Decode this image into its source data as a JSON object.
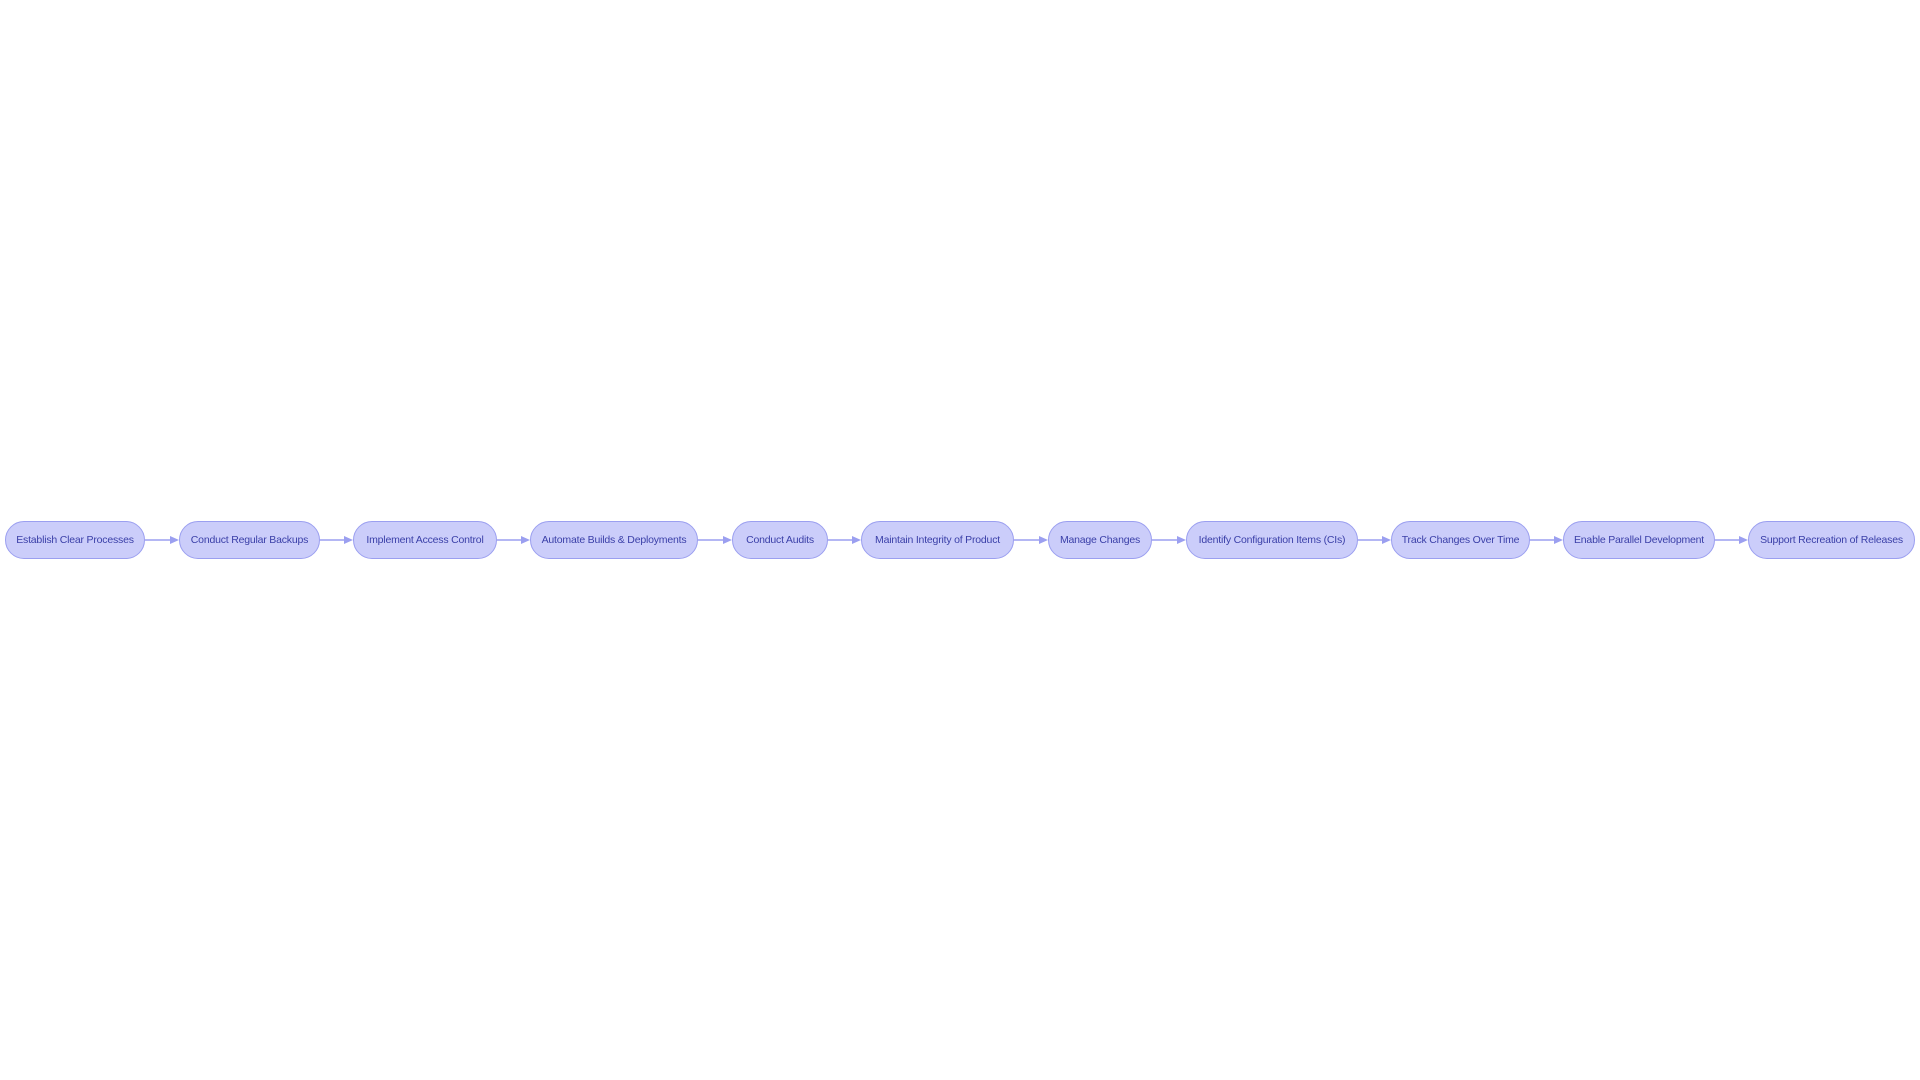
{
  "diagram": {
    "type": "flowchart",
    "direction": "left-to-right",
    "colors": {
      "node_fill": "#cbcdfa",
      "node_border": "#9b9ff0",
      "node_text": "#3a3fa8",
      "edge": "#9b9ff0",
      "background": "#ffffff"
    },
    "nodes": [
      {
        "id": "n1",
        "label": "Establish Clear Processes"
      },
      {
        "id": "n2",
        "label": "Conduct Regular Backups"
      },
      {
        "id": "n3",
        "label": "Implement Access Control"
      },
      {
        "id": "n4",
        "label": "Automate Builds & Deployments"
      },
      {
        "id": "n5",
        "label": "Conduct Audits"
      },
      {
        "id": "n6",
        "label": "Maintain Integrity of Product"
      },
      {
        "id": "n7",
        "label": "Manage Changes"
      },
      {
        "id": "n8",
        "label": "Identify Configuration Items (CIs)"
      },
      {
        "id": "n9",
        "label": "Track Changes Over Time"
      },
      {
        "id": "n10",
        "label": "Enable Parallel Development"
      },
      {
        "id": "n11",
        "label": "Support Recreation of Releases"
      }
    ],
    "edges": [
      {
        "from": "n1",
        "to": "n2"
      },
      {
        "from": "n2",
        "to": "n3"
      },
      {
        "from": "n3",
        "to": "n4"
      },
      {
        "from": "n4",
        "to": "n5"
      },
      {
        "from": "n5",
        "to": "n6"
      },
      {
        "from": "n6",
        "to": "n7"
      },
      {
        "from": "n7",
        "to": "n8"
      },
      {
        "from": "n8",
        "to": "n9"
      },
      {
        "from": "n9",
        "to": "n10"
      },
      {
        "from": "n10",
        "to": "n11"
      }
    ]
  }
}
